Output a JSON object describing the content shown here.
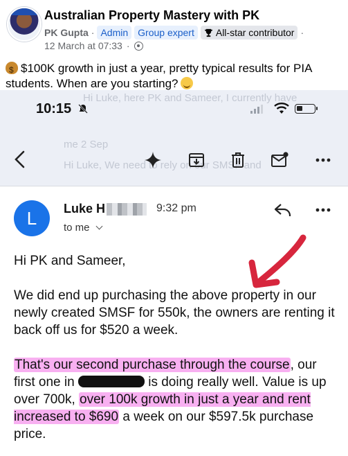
{
  "post": {
    "group_name": "Australian Property Mastery with PK",
    "author": "PK Gupta",
    "separator": "·",
    "badges": [
      "Admin",
      "Group expert",
      "All-star contributor"
    ],
    "date": "12 March at 07:33",
    "text_main": "$100K growth in just a year, pretty typical results for PIA students. When are you starting?"
  },
  "screenshot": {
    "status_time": "10:15",
    "bg_previous": {
      "line1": "Hi Luke, here PK and Sameer, I currently have",
      "line2": "me  2 Sep",
      "line3": "Hi Luke, We need to rely on our SMSF and"
    },
    "email": {
      "avatar_letter": "L",
      "sender": "Luke H",
      "time": "9:32 pm",
      "to": "to me",
      "greeting": "Hi PK and Sameer,",
      "para1": "We did end up purchasing the above property in our newly created SMSF for 550k, the owners are renting it back off us for $520 a week.",
      "para2_hl1": "That's our second purchase through the course",
      "para2_a": ", our first one in",
      "para2_b": "is doing really well. Value is up over 700k,",
      "para2_hl2": "over 100k growth in just a year and rent increased to $690",
      "para2_c": "a week on our $597.5k purchase price."
    }
  }
}
